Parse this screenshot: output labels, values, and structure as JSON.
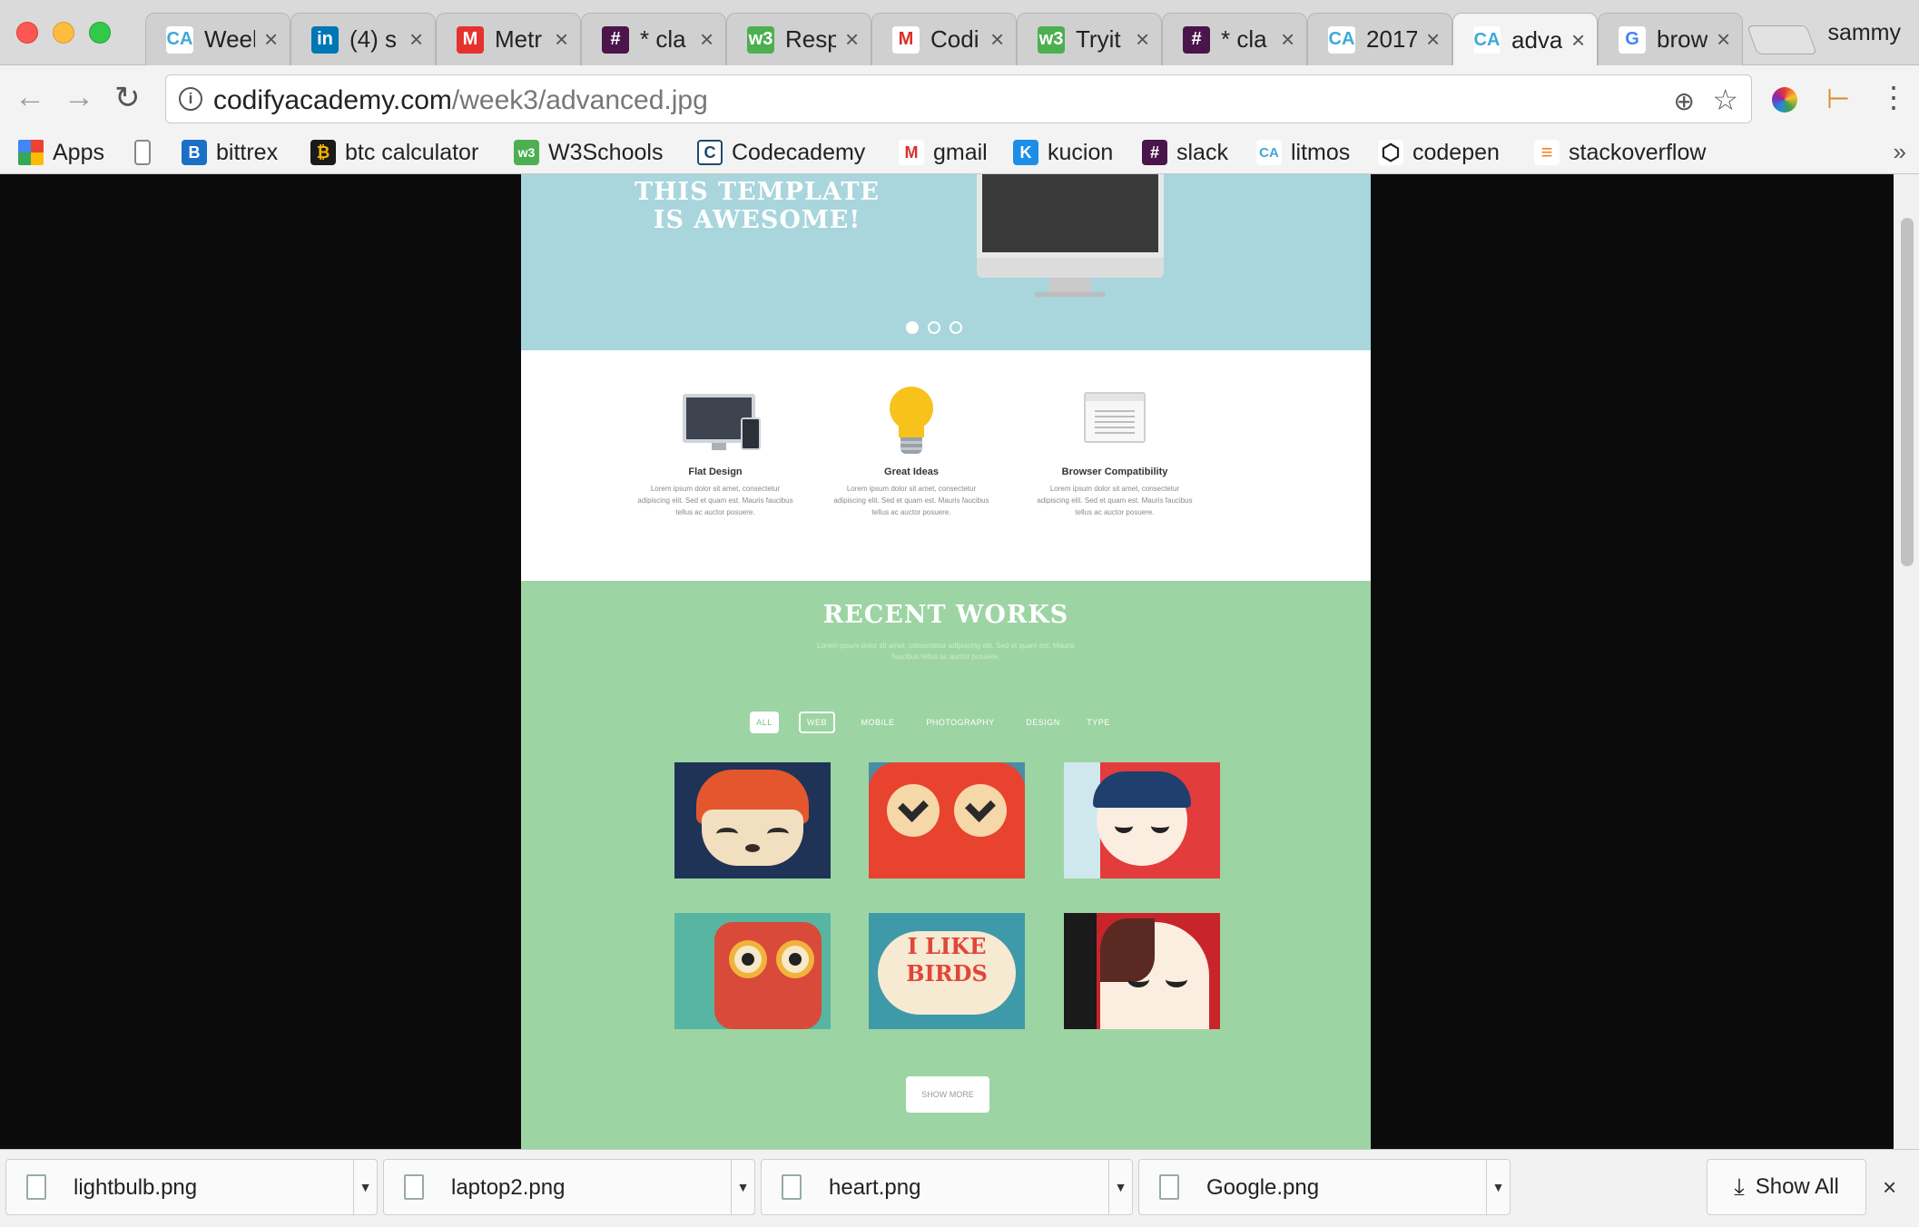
{
  "browser": {
    "profile": "sammy",
    "tabs": [
      {
        "title": "Week",
        "favicon": "CA",
        "color": "#ffffff",
        "fg": "#3fa9d8"
      },
      {
        "title": "(4) s",
        "favicon": "in",
        "color": "#0077b5",
        "fg": "#ffffff"
      },
      {
        "title": "Metr",
        "favicon": "M",
        "color": "#e5312f",
        "fg": "#ffffff"
      },
      {
        "title": "* cla",
        "favicon": "#",
        "color": "#4a154b",
        "fg": "#ffffff"
      },
      {
        "title": "Resp",
        "favicon": "w3",
        "color": "#4caf50",
        "fg": "#ffffff"
      },
      {
        "title": "Codi",
        "favicon": "M",
        "color": "#ffffff",
        "fg": "#d93025"
      },
      {
        "title": "Tryit",
        "favicon": "w3",
        "color": "#4caf50",
        "fg": "#ffffff"
      },
      {
        "title": "* cla",
        "favicon": "#",
        "color": "#4a154b",
        "fg": "#ffffff"
      },
      {
        "title": "2017",
        "favicon": "CA",
        "color": "#ffffff",
        "fg": "#3fa9d8"
      },
      {
        "title": "adva",
        "favicon": "CA",
        "color": "#ffffff",
        "fg": "#3fa9d8",
        "active": true
      },
      {
        "title": "brow",
        "favicon": "G",
        "color": "#ffffff",
        "fg": "#4285f4"
      }
    ],
    "url_host": "codifyacademy.com",
    "url_path": "/week3/advanced.jpg",
    "bookmarks": [
      {
        "label": "Apps",
        "favicon": "apps-grid-icon"
      },
      {
        "label": "",
        "favicon": "page-icon"
      },
      {
        "label": "bittrex",
        "favicon": "B"
      },
      {
        "label": "btc calculator",
        "favicon": "btc-icon"
      },
      {
        "label": "W3Schools",
        "favicon": "w3"
      },
      {
        "label": "Codecademy",
        "favicon": "C"
      },
      {
        "label": "gmail",
        "favicon": "M"
      },
      {
        "label": "kucion",
        "favicon": "K"
      },
      {
        "label": "slack",
        "favicon": "#"
      },
      {
        "label": "litmos",
        "favicon": "CA"
      },
      {
        "label": "codepen",
        "favicon": "codepen-icon"
      },
      {
        "label": "stackoverflow",
        "favicon": "stackoverflow-icon"
      }
    ]
  },
  "page": {
    "hero_title": "THIS TEMPLATE\nIS AWESOME!",
    "features": [
      {
        "title": "Flat Design",
        "text": "Lorem ipsum dolor sit amet, consectetur adipiscing elit. Sed et quam est. Mauris faucibus tellus ac auctor posuere.",
        "icon": "devices-icon"
      },
      {
        "title": "Great Ideas",
        "text": "Lorem ipsum dolor sit amet, consectetur adipiscing elit. Sed et quam est. Mauris faucibus tellus ac auctor posuere.",
        "icon": "lightbulb-icon"
      },
      {
        "title": "Browser Compatibility",
        "text": "Lorem ipsum dolor sit amet, consectetur adipiscing elit. Sed et quam est. Mauris faucibus tellus ac auctor posuere.",
        "icon": "browser-window-icon"
      }
    ],
    "works_title": "RECENT WORKS",
    "works_subtitle": "Lorem ipsum dolor sit amet, consectetur adipiscing elit. Sed et quam est. Mauris faucibus tellus ac auctor posuere.",
    "filters": [
      "ALL",
      "WEB",
      "MOBILE",
      "PHOTOGRAPHY",
      "DESIGN",
      "TYPE"
    ],
    "birds_text": "I LIKE BIRDS",
    "show_more": "SHOW MORE"
  },
  "downloads": {
    "items": [
      "lightbulb.png",
      "laptop2.png",
      "heart.png",
      "Google.png"
    ],
    "show_all": "Show All"
  }
}
